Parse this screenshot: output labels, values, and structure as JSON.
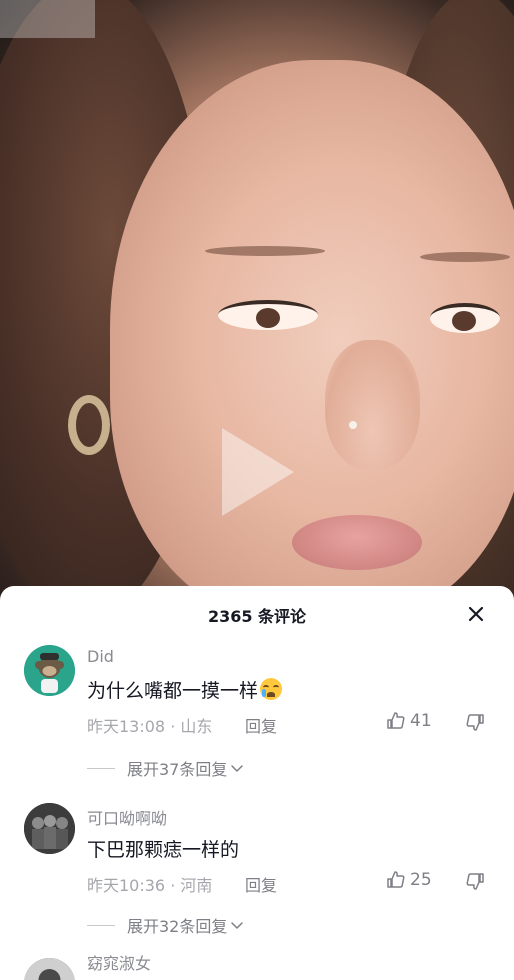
{
  "video": {
    "play_icon": "play-icon"
  },
  "comments_sheet": {
    "title": "2365 条评论",
    "close_icon": "close-icon",
    "comments": [
      {
        "username": "Did",
        "text": "为什么嘴都一摸一样",
        "emoji": "crying-face-emoji",
        "meta": "昨天13:08 · 山东",
        "reply_label": "回复",
        "likes": "41",
        "expand_label": "展开37条回复"
      },
      {
        "username": "可口呦啊呦",
        "text": "下巴那颗痣一样的",
        "meta": "昨天10:36 · 河南",
        "reply_label": "回复",
        "likes": "25",
        "expand_label": "展开32条回复"
      },
      {
        "username": "窈窕淑女"
      }
    ]
  }
}
